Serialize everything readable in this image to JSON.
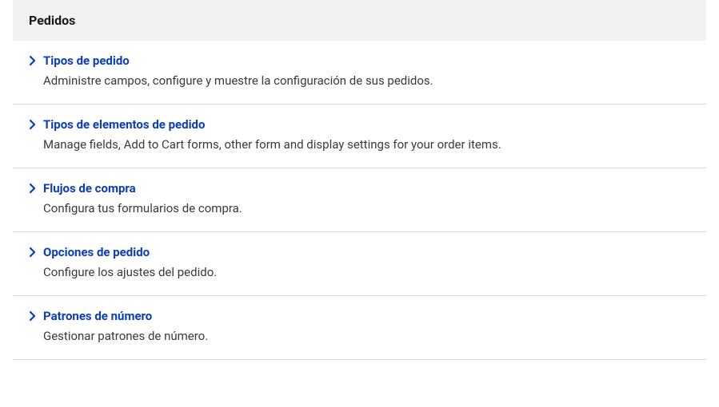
{
  "section": {
    "title": "Pedidos"
  },
  "items": [
    {
      "title": "Tipos de pedido",
      "description": "Administre campos, configure y muestre la configuración de sus pedidos."
    },
    {
      "title": "Tipos de elementos de pedido",
      "description": "Manage fields, Add to Cart forms, other form and display settings for your order items."
    },
    {
      "title": "Flujos de compra",
      "description": "Configura tus formularios de compra."
    },
    {
      "title": "Opciones de pedido",
      "description": "Configure los ajustes del pedido."
    },
    {
      "title": "Patrones de número",
      "description": "Gestionar patrones de número."
    }
  ]
}
